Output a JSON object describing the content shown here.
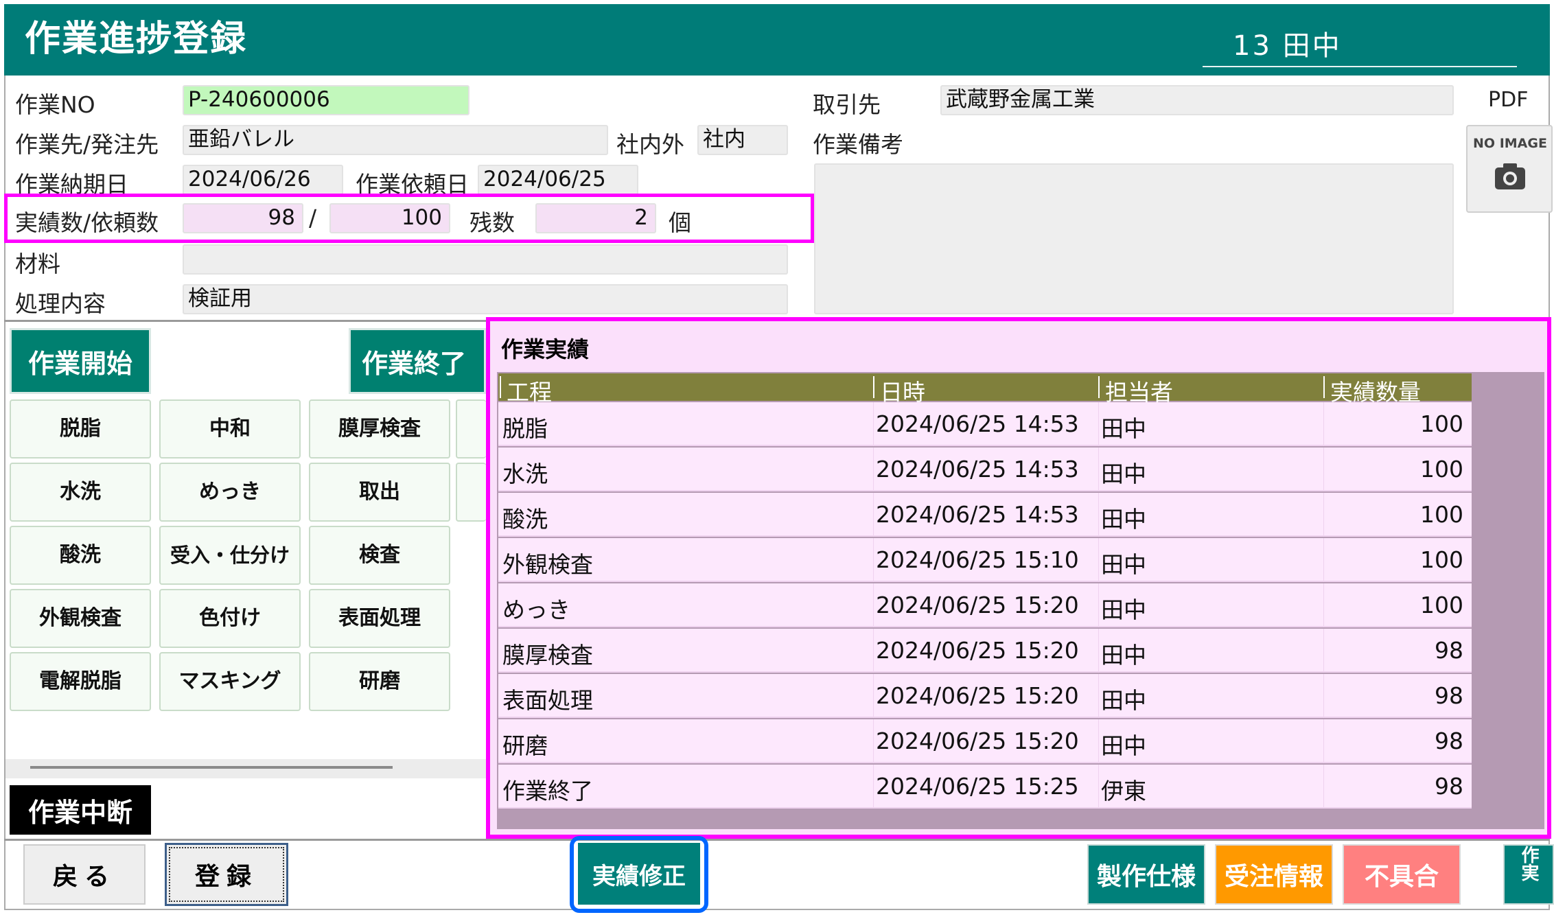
{
  "header": {
    "title": "作業進捗登録",
    "user": "13 田中"
  },
  "form": {
    "work_no_label": "作業NO",
    "work_no": "P-240600006",
    "dest_label": "作業先/発注先",
    "dest": "亜鉛バレル",
    "inout_label": "社内外",
    "inout": "社内",
    "due_label": "作業納期日",
    "due": "2024/06/26",
    "req_label": "作業依頼日",
    "req": "2024/06/25",
    "qty_label": "実績数/依頼数",
    "actual": "98",
    "slash": "/",
    "requested": "100",
    "remain_label": "残数",
    "remain": "2",
    "unit": "個",
    "material_label": "材料",
    "material": "",
    "process_label": "処理内容",
    "process": "検証用",
    "client_label": "取引先",
    "client": "武蔵野金属工業",
    "notes_label": "作業備考",
    "notes": "",
    "pdf_label": "PDF",
    "noimage_label": "NO IMAGE"
  },
  "actions": {
    "start": "作業開始",
    "end": "作業終了",
    "interrupt": "作業中断",
    "processes": [
      "脱脂",
      "中和",
      "膜厚検査",
      "水洗",
      "めっき",
      "取出",
      "酸洗",
      "受入・仕分け",
      "検査",
      "外観検査",
      "色付け",
      "表面処理",
      "電解脱脂",
      "マスキング",
      "研磨"
    ]
  },
  "results": {
    "title": "作業実績",
    "columns": [
      "工程",
      "日時",
      "担当者",
      "実績数量"
    ],
    "rows": [
      [
        "脱脂",
        "2024/06/25 14:53",
        "田中",
        "100"
      ],
      [
        "水洗",
        "2024/06/25 14:53",
        "田中",
        "100"
      ],
      [
        "酸洗",
        "2024/06/25 14:53",
        "田中",
        "100"
      ],
      [
        "外観検査",
        "2024/06/25 15:10",
        "田中",
        "100"
      ],
      [
        "めっき",
        "2024/06/25 15:20",
        "田中",
        "100"
      ],
      [
        "膜厚検査",
        "2024/06/25 15:20",
        "田中",
        "98"
      ],
      [
        "表面処理",
        "2024/06/25 15:20",
        "田中",
        "98"
      ],
      [
        "研磨",
        "2024/06/25 15:20",
        "田中",
        "98"
      ],
      [
        "作業終了",
        "2024/06/25 15:25",
        "伊東",
        "98"
      ]
    ]
  },
  "footer": {
    "back": "戻る",
    "register": "登録",
    "fix": "実績修正",
    "spec": "製作仕様",
    "order": "受注情報",
    "defect": "不具合",
    "cut": "作実"
  },
  "colors": {
    "header": "#007c78",
    "highlight": "#ff00ff",
    "focus": "#0066ff",
    "order": "#ff9900",
    "defect": "#ff8080"
  }
}
